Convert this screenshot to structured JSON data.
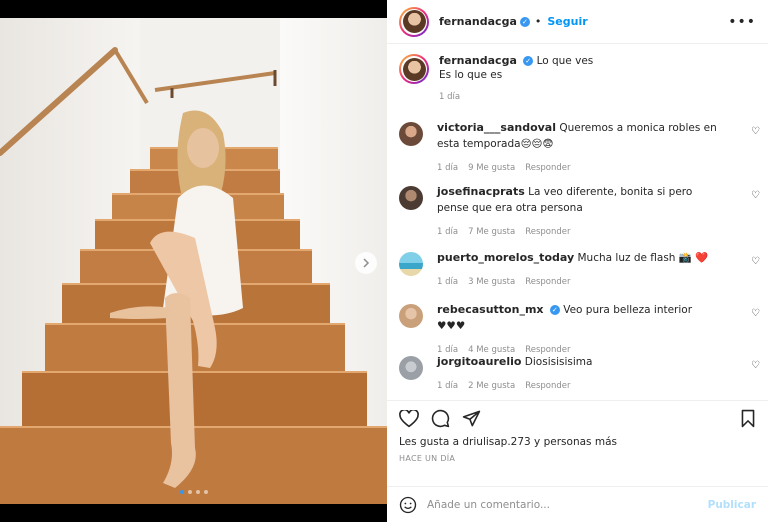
{
  "post": {
    "username": "fernandacga",
    "follow_label": "Seguir",
    "separator": "•",
    "more_icon": "more-horizontal-icon",
    "caption_line1": "Lo que ves",
    "caption_line2": "Es lo que es",
    "caption_time": "1 día"
  },
  "media": {
    "carousel_dots": 4,
    "active_dot": 1,
    "next_icon": "chevron-right-icon"
  },
  "comments": [
    {
      "username": "victoria___sandoval",
      "verified": false,
      "text": "Queremos a monica robles en esta temporada😔😔😨",
      "time": "1 día",
      "likes": "9 Me gusta",
      "reply": "Responder",
      "avatar_color": "#6b4a3a"
    },
    {
      "username": "josefinacprats",
      "verified": false,
      "text": "La veo diferente, bonita si pero pense que era otra persona",
      "time": "1 día",
      "likes": "7 Me gusta",
      "reply": "Responder",
      "avatar_color": "#4b3b33"
    },
    {
      "username": "puerto_morelos_today",
      "verified": false,
      "text": "Mucha luz de flash 📸 ❤️",
      "time": "1 día",
      "likes": "3 Me gusta",
      "reply": "Responder",
      "avatar_color": "#3aa6c9"
    },
    {
      "username": "rebecasutton_mx",
      "verified": true,
      "text": "Veo pura belleza interior ♥♥♥",
      "time": "1 día",
      "likes": "4 Me gusta",
      "reply": "Responder",
      "avatar_color": "#c9a07a"
    },
    {
      "username": "jorgitoaurelio",
      "verified": false,
      "text": "Diosisisisima",
      "time": "1 día",
      "likes": "2 Me gusta",
      "reply": "Responder",
      "avatar_color": "#9aa0a6"
    }
  ],
  "actions": {
    "likes_text": "Les gusta a driulisap.273 y personas más",
    "posted_time": "HACE UN DÍA",
    "comment_placeholder": "Añade un comentario...",
    "publish_label": "Publicar"
  },
  "colors": {
    "accent": "#0095f6",
    "verified": "#3897f0",
    "muted": "#8e8e8e",
    "wood": "#c07f45"
  }
}
